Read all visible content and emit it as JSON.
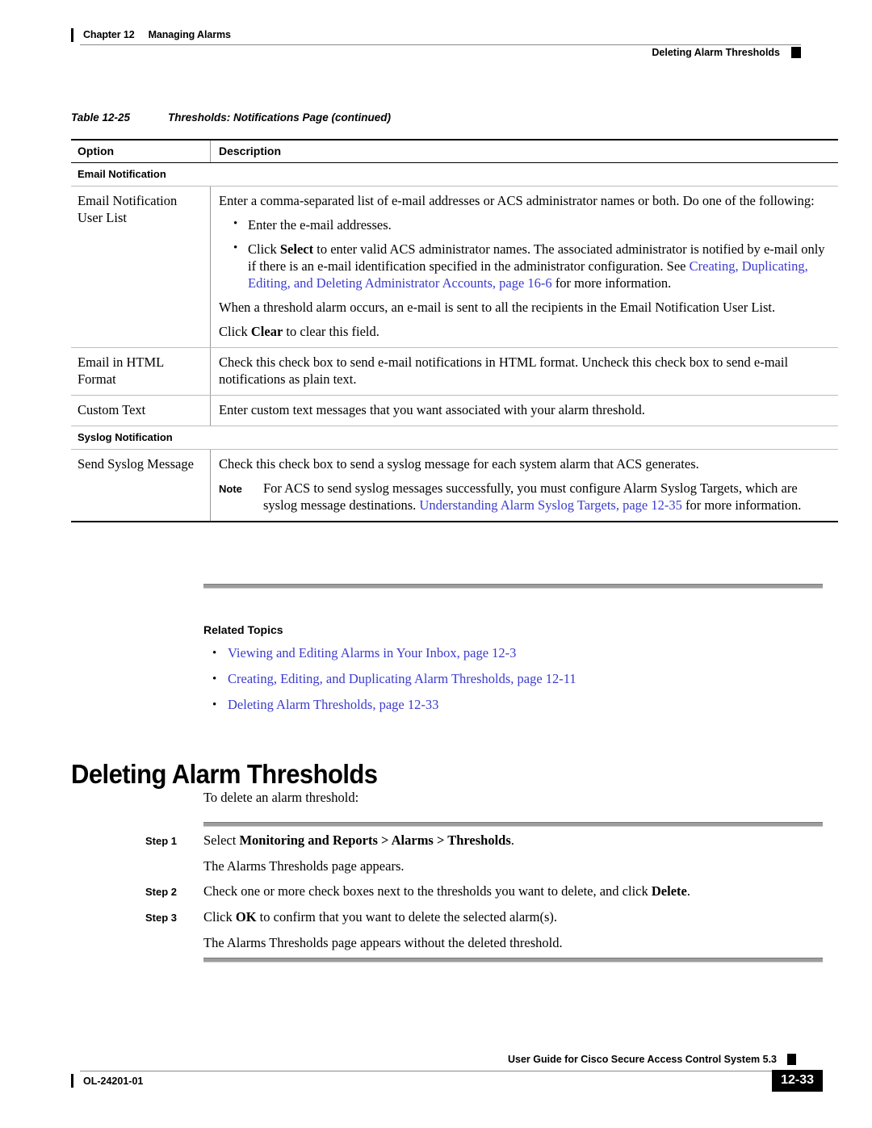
{
  "header": {
    "chapter": "Chapter 12",
    "chapter_title": "Managing Alarms",
    "topic": "Deleting Alarm Thresholds"
  },
  "table": {
    "caption_number": "Table 12-25",
    "caption_title": "Thresholds: Notifications Page (continued)",
    "columns": [
      "Option",
      "Description"
    ],
    "sections": [
      {
        "subhead": "Email Notification",
        "rows": [
          {
            "option": "Email Notification User List",
            "description_intro": "Enter a comma-separated list of e-mail addresses or ACS administrator names or both. Do one of the following:",
            "bullets": [
              {
                "pre": "Enter the e-mail addresses.",
                "bold": "",
                "post": "",
                "link": "",
                "tail": ""
              },
              {
                "pre": "Click ",
                "bold": "Select",
                "post": " to enter valid ACS administrator names. The associated administrator is notified by e-mail only if there is an e-mail identification specified in the administrator configuration. See ",
                "link": "Creating, Duplicating, Editing, and Deleting Administrator Accounts, page 16-6",
                "tail": " for more information."
              }
            ],
            "paragraphs": [
              "When a threshold alarm occurs, an e-mail is sent to all the recipients in the Email Notification User List."
            ],
            "final_pre": "Click ",
            "final_bold": "Clear",
            "final_post": " to clear this field."
          },
          {
            "option": "Email in HTML Format",
            "description_intro": "Check this check box to send e-mail notifications in HTML format. Uncheck this check box to send e-mail notifications as plain text.",
            "bullets": [],
            "paragraphs": [],
            "final_pre": "",
            "final_bold": "",
            "final_post": ""
          },
          {
            "option": "Custom Text",
            "description_intro": "Enter custom text messages that you want associated with your alarm threshold.",
            "bullets": [],
            "paragraphs": [],
            "final_pre": "",
            "final_bold": "",
            "final_post": ""
          }
        ]
      },
      {
        "subhead": "Syslog Notification",
        "rows": [
          {
            "option": "Send Syslog Message",
            "description_intro": "Check this check box to send a syslog message for each system alarm that ACS generates.",
            "note_label": "Note",
            "note_pre": "For ACS to send syslog messages successfully, you must configure Alarm Syslog Targets, which are syslog message destinations. ",
            "note_link": "Understanding Alarm Syslog Targets, page 12-35",
            "note_tail": " for more information."
          }
        ]
      }
    ]
  },
  "related_topics": {
    "title": "Related Topics",
    "items": [
      "Viewing and Editing Alarms in Your Inbox, page 12-3",
      "Creating, Editing, and Duplicating Alarm Thresholds, page 12-11",
      "Deleting Alarm Thresholds, page 12-33"
    ],
    "bullet_glyph": "•"
  },
  "section": {
    "heading": "Deleting Alarm Thresholds",
    "lead_in": "To delete an alarm threshold:"
  },
  "steps": [
    {
      "label": "Step 1",
      "pre": "Select ",
      "bold": "Monitoring and Reports > Alarms > Thresholds",
      "post": ".",
      "result": "The Alarms Thresholds page appears."
    },
    {
      "label": "Step 2",
      "pre": "Check one or more check boxes next to the thresholds you want to delete, and click ",
      "bold": "Delete",
      "post": ".",
      "result": ""
    },
    {
      "label": "Step 3",
      "pre": "Click ",
      "bold": "OK",
      "post": " to confirm that you want to delete the selected alarm(s).",
      "result": "The Alarms Thresholds page appears without the deleted threshold."
    }
  ],
  "footer": {
    "doc_id": "OL-24201-01",
    "guide_title": "User Guide for Cisco Secure Access Control System 5.3",
    "page_number": "12-33"
  },
  "colors": {
    "link": "#3b3bcf",
    "rule_gray": "#9d9d9d",
    "table_border": "#bdbdbd",
    "text": "#000000"
  }
}
